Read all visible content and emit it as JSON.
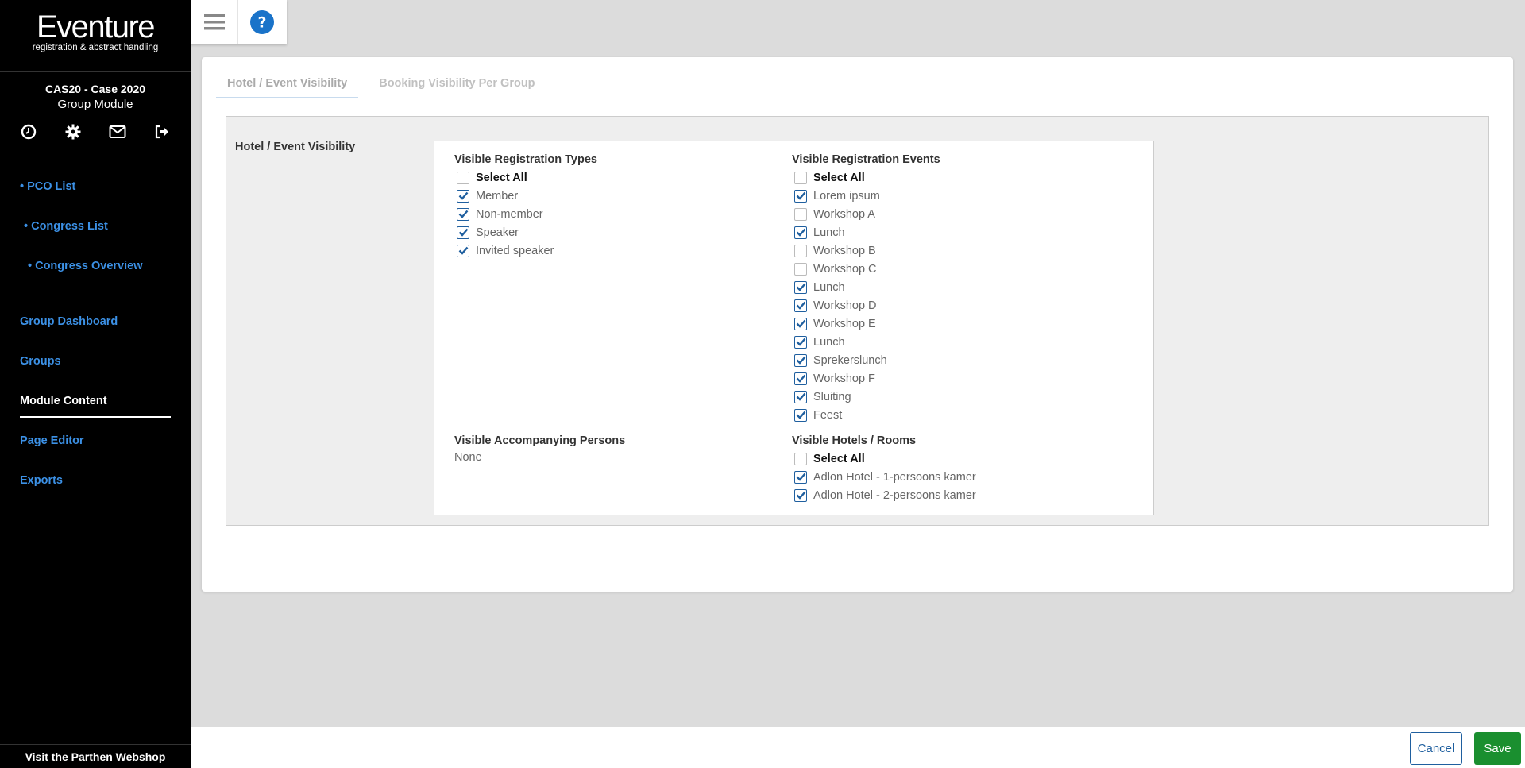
{
  "app": {
    "logo_title": "Eventure",
    "logo_subtitle": "registration & abstract handling",
    "event_name": "CAS20 - Case 2020",
    "module_name": "Group Module",
    "webshop_link": "Visit the Parthen Webshop"
  },
  "sidebar_icons": [
    "clock-icon",
    "gear-icon",
    "envelope-icon",
    "logout-icon"
  ],
  "nav": {
    "pco_list": "• PCO List",
    "congress_list": "• Congress List",
    "congress_overview": "• Congress Overview",
    "group_dashboard": "Group Dashboard",
    "groups": "Groups",
    "module_content": "Module Content",
    "page_editor": "Page Editor",
    "exports": "Exports"
  },
  "toolbar_icons": [
    "hamburger-menu-icon",
    "help-icon"
  ],
  "tabs": {
    "hotel_event_visibility": "Hotel / Event Visibility",
    "booking_visibility": "Booking Visibility Per Group"
  },
  "panel": {
    "label": "Hotel / Event Visibility",
    "registration_types": {
      "title": "Visible Registration Types",
      "select_all": "Select All",
      "select_all_checked": false,
      "items": [
        {
          "label": "Member",
          "checked": true
        },
        {
          "label": "Non-member",
          "checked": true
        },
        {
          "label": "Speaker",
          "checked": true
        },
        {
          "label": "Invited speaker",
          "checked": true
        }
      ]
    },
    "registration_events": {
      "title": "Visible Registration Events",
      "select_all": "Select All",
      "select_all_checked": false,
      "items": [
        {
          "label": "Lorem ipsum",
          "checked": true
        },
        {
          "label": "Workshop A",
          "checked": false
        },
        {
          "label": "Lunch",
          "checked": true
        },
        {
          "label": "Workshop B",
          "checked": false
        },
        {
          "label": "Workshop C",
          "checked": false
        },
        {
          "label": "Lunch",
          "checked": true
        },
        {
          "label": "Workshop D",
          "checked": true
        },
        {
          "label": "Workshop E",
          "checked": true
        },
        {
          "label": "Lunch",
          "checked": true
        },
        {
          "label": "Sprekerslunch",
          "checked": true
        },
        {
          "label": "Workshop F",
          "checked": true
        },
        {
          "label": "Sluiting",
          "checked": true
        },
        {
          "label": "Feest",
          "checked": true
        }
      ]
    },
    "accompanying_persons": {
      "title": "Visible Accompanying Persons",
      "value": "None"
    },
    "hotels_rooms": {
      "title": "Visible Hotels / Rooms",
      "select_all": "Select All",
      "select_all_checked": false,
      "items": [
        {
          "label": "Adlon Hotel - 1-persoons kamer",
          "checked": true
        },
        {
          "label": "Adlon Hotel - 2-persoons kamer",
          "checked": true
        }
      ]
    }
  },
  "buttons": {
    "cancel": "Cancel",
    "save": "Save"
  },
  "colors": {
    "sidebar_bg": "#000000",
    "nav_link": "#3c91e6",
    "checkbox_check": "#1f5f9f",
    "save_button": "#1a8f2f"
  }
}
